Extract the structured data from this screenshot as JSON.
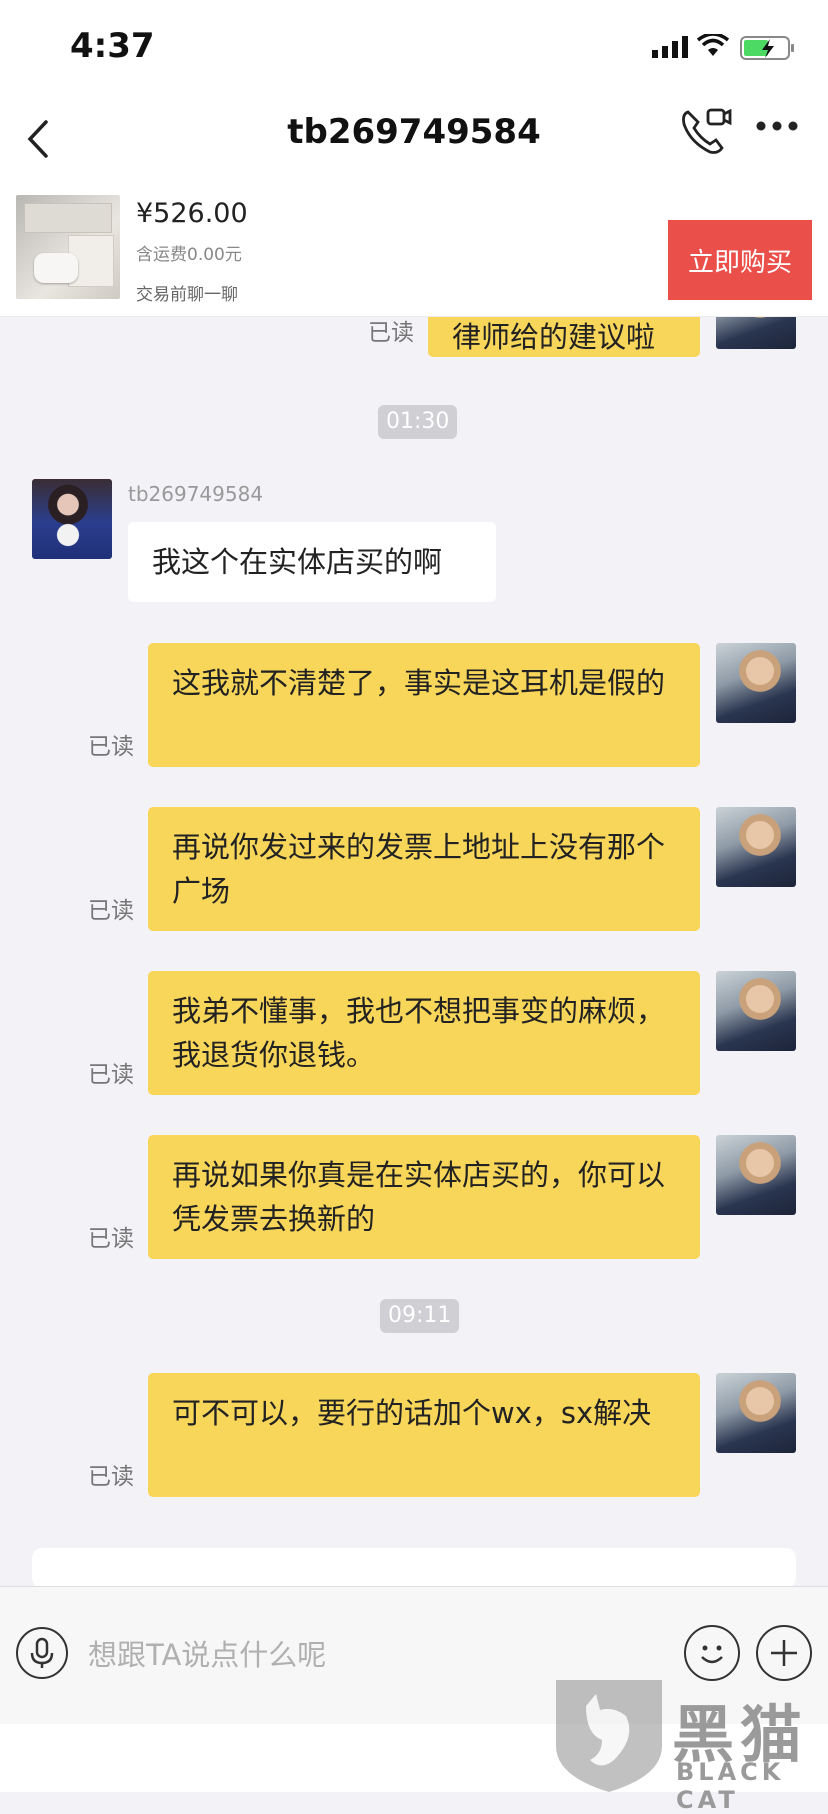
{
  "status_bar": {
    "time": "4:37"
  },
  "nav": {
    "title": "tb269749584"
  },
  "product": {
    "price": "¥526.00",
    "shipping": "含运费0.00元",
    "chat_hint": "交易前聊一聊",
    "buy_label": "立即购买"
  },
  "conversation": {
    "read_label": "已读",
    "partial_message": "律师给的建议啦",
    "timestamps": [
      "01:30",
      "09:11"
    ],
    "peer_name": "tb269749584",
    "peer_message": "我这个在实体店买的啊",
    "my_messages": [
      "这我就不清楚了，事实是这耳机是假的",
      "再说你发过来的发票上地址上没有那个广场",
      "我弟不懂事，我也不想把事变的麻烦，我退货你退钱。",
      "再说如果你真是在实体店买的，你可以凭发票去换新的",
      "可不可以，要行的话加个wx，sx解决"
    ]
  },
  "input_bar": {
    "placeholder": "想跟TA说点什么呢"
  },
  "watermark": {
    "text": "黑猫",
    "sub": "BLACK CAT"
  },
  "colors": {
    "my_bubble": "#f8d65a",
    "buy_button": "#ea4f4a",
    "background": "#f2f2f7"
  }
}
